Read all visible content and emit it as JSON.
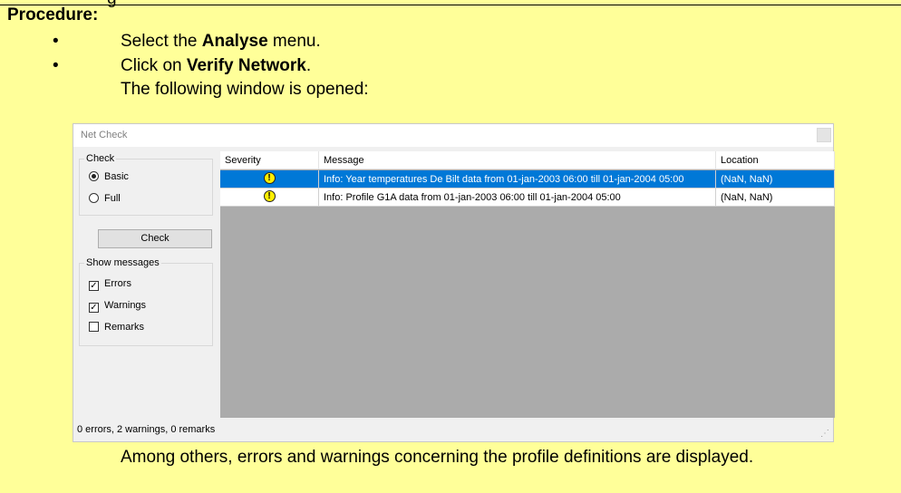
{
  "top_fragment": "g",
  "procedure_title": "Procedure:",
  "steps": [
    {
      "prefix": "Select the ",
      "bold": "Analyse",
      "suffix": " menu."
    },
    {
      "prefix": "Click on ",
      "bold": "Verify Network",
      "suffix": "."
    }
  ],
  "bullet_glyph": "•",
  "intro_line": "The following window is opened:",
  "dialog": {
    "title": "Net Check",
    "check_group": {
      "legend": "Check",
      "options": [
        {
          "label": "Basic",
          "selected": true
        },
        {
          "label": "Full",
          "selected": false
        }
      ]
    },
    "check_button": "Check",
    "show_messages": {
      "legend": "Show messages",
      "items": [
        {
          "label": "Errors",
          "checked": true
        },
        {
          "label": "Warnings",
          "checked": true
        },
        {
          "label": "Remarks",
          "checked": false
        }
      ]
    },
    "grid": {
      "columns": [
        "Severity",
        "Message",
        "Location"
      ],
      "rows": [
        {
          "severity_icon": "warning-icon",
          "message": "Info: Year temperatures De Bilt data from 01-jan-2003 06:00 till 01-jan-2004 05:00",
          "location": "(NaN, NaN)",
          "selected": true
        },
        {
          "severity_icon": "warning-icon",
          "message": "Info: Profile G1A data from 01-jan-2003 06:00 till 01-jan-2004 05:00",
          "location": "(NaN, NaN)",
          "selected": false
        }
      ]
    },
    "status": "0 errors, 2 warnings, 0 remarks",
    "colors": {
      "selection": "#0078d7",
      "grid_background": "#ababab",
      "page_background": "#ffff99"
    }
  },
  "after_text": "Among others, errors and warnings concerning the profile definitions are displayed."
}
